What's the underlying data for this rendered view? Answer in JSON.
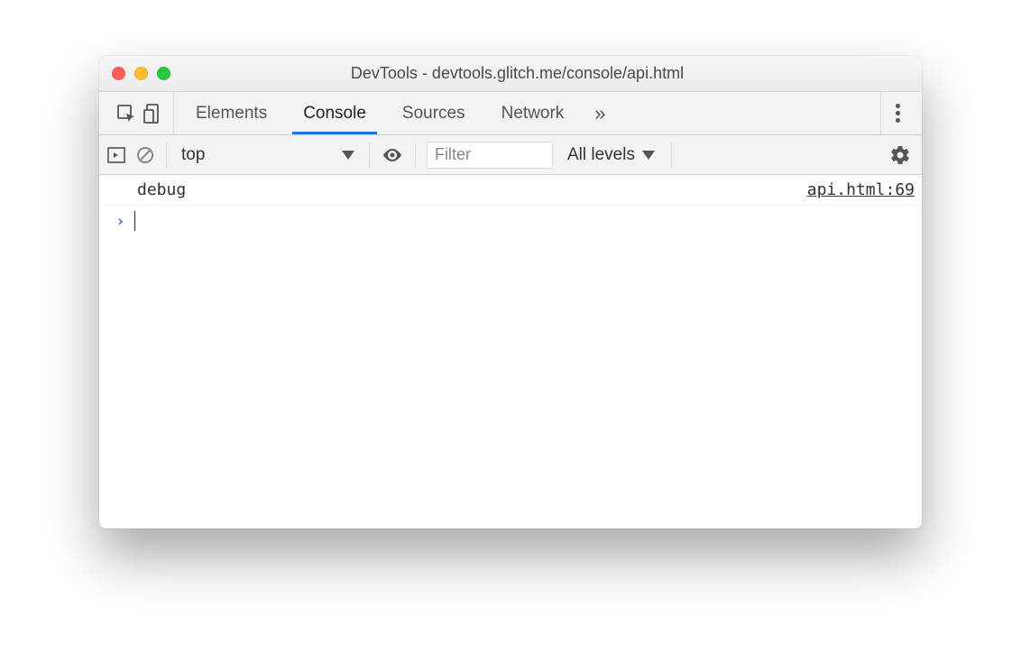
{
  "window": {
    "title": "DevTools - devtools.glitch.me/console/api.html"
  },
  "tabs": {
    "elements": "Elements",
    "console": "Console",
    "sources": "Sources",
    "network": "Network"
  },
  "toolbar": {
    "context": "top",
    "filter_placeholder": "Filter",
    "levels": "All levels"
  },
  "console": {
    "log": {
      "message": "debug",
      "source": "api.html:69"
    }
  }
}
